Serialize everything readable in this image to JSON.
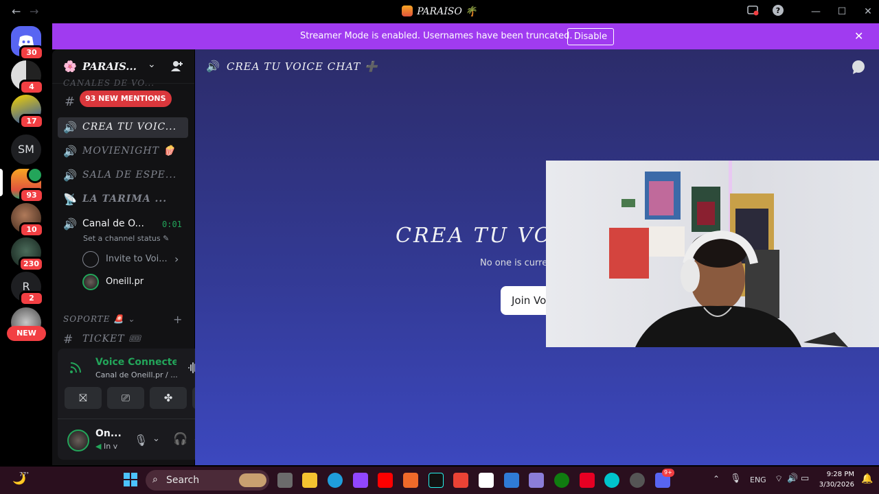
{
  "window": {
    "title": "PARAISO",
    "title_emoji": "🌴"
  },
  "banner": {
    "text": "Streamer Mode is enabled. Usernames have been truncated.",
    "disable_label": "Disable"
  },
  "rail": {
    "home_badge": "30",
    "servers": [
      {
        "badge": "4"
      },
      {
        "badge": "17"
      },
      {
        "text": "SM"
      },
      {
        "badge": "93"
      },
      {
        "badge": "10"
      },
      {
        "badge": "230"
      },
      {
        "text": "R",
        "badge": "2"
      }
    ],
    "new_label": "NEW"
  },
  "sidebar": {
    "server_name": "PARAIS...",
    "top_category": "CANALES DE VO...",
    "mentions_label": "93 NEW MENTIONS",
    "channels": [
      {
        "label": "CREA TU VOIC...",
        "type": "voice-create"
      },
      {
        "label": "MOVIENIGHT 🍿",
        "type": "voice-locked"
      },
      {
        "label": "SALA DE ESPE...",
        "type": "voice-locked"
      },
      {
        "label": "LA TARIMA ...",
        "type": "stage"
      }
    ],
    "active_voice": {
      "label": "Canal de O...",
      "timer": "0:01",
      "status": "Set a channel status"
    },
    "invite_label": "Invite to Voi...",
    "member": "Oneill.pr",
    "support_category": "SOPORTE 🚨",
    "ticket_channel": "TICKET 🎟"
  },
  "voice_panel": {
    "status": "Voice Connected",
    "channel": "Canal de Oneill.pr / ...",
    "user_name": "On...",
    "user_status": "In v"
  },
  "main": {
    "header_title": "CREA TU VOICE CHAT ➕",
    "big_title": "CREA TU VOICE CHAT",
    "subtitle": "No one is currently in voice",
    "join_label": "Join Voice"
  },
  "taskbar": {
    "weather": "77°",
    "search_label": "Search",
    "lang": "ENG",
    "time": "9:28 PM",
    "date": "3/30/2026",
    "discord_badge": "9+"
  },
  "colors": {
    "accent": "#a03bf0",
    "badge": "#f23f43",
    "voice": "#23a55a"
  }
}
